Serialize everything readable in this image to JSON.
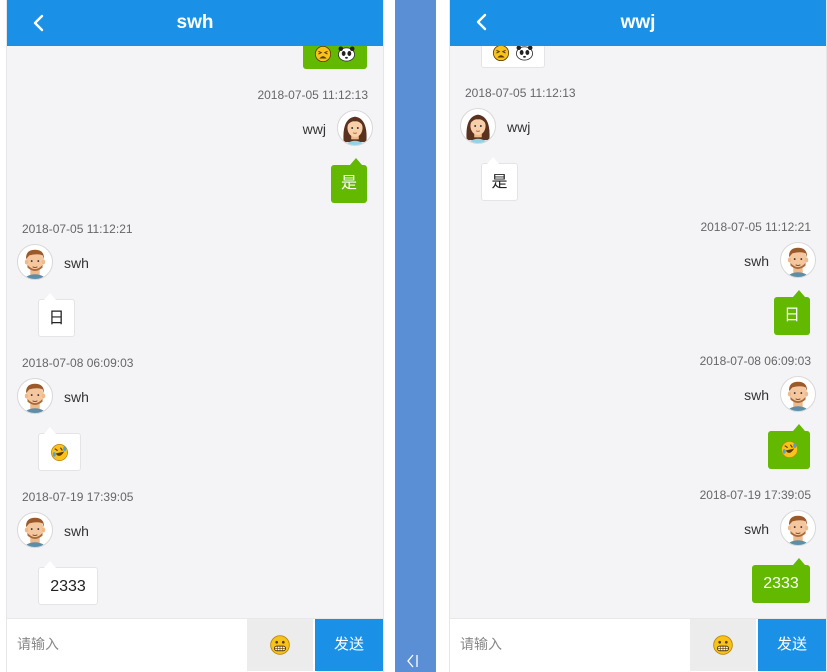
{
  "colors": {
    "header": "#1a90e6",
    "self_bubble": "#62b900",
    "divider": "#5a8fd6"
  },
  "left_chat": {
    "title": "swh",
    "messages": [
      {
        "time": "2018-07-05 11:12:13",
        "user": "wwj",
        "text": "是"
      },
      {
        "time": "2018-07-05 11:12:21",
        "user": "swh",
        "text": "日"
      },
      {
        "time": "2018-07-08 06:09:03",
        "user": "swh",
        "emoji": "rofl-emoji"
      },
      {
        "time": "2018-07-19 17:39:05",
        "user": "swh",
        "text": "2333"
      }
    ],
    "input_placeholder": "请输入",
    "send_label": "发送"
  },
  "right_chat": {
    "title": "wwj",
    "messages": [
      {
        "time": "2018-07-05 11:12:13",
        "user": "wwj",
        "text": "是"
      },
      {
        "time": "2018-07-05 11:12:21",
        "user": "swh",
        "text": "日"
      },
      {
        "time": "2018-07-08 06:09:03",
        "user": "swh",
        "emoji": "rofl-emoji"
      },
      {
        "time": "2018-07-19 17:39:05",
        "user": "swh",
        "text": "2333"
      }
    ],
    "input_placeholder": "请输入",
    "send_label": "发送"
  },
  "icons": {
    "back": "chevron-left-icon",
    "emoji_button": "grinning-face-icon",
    "panel_toggle": "collapse-left-icon"
  }
}
